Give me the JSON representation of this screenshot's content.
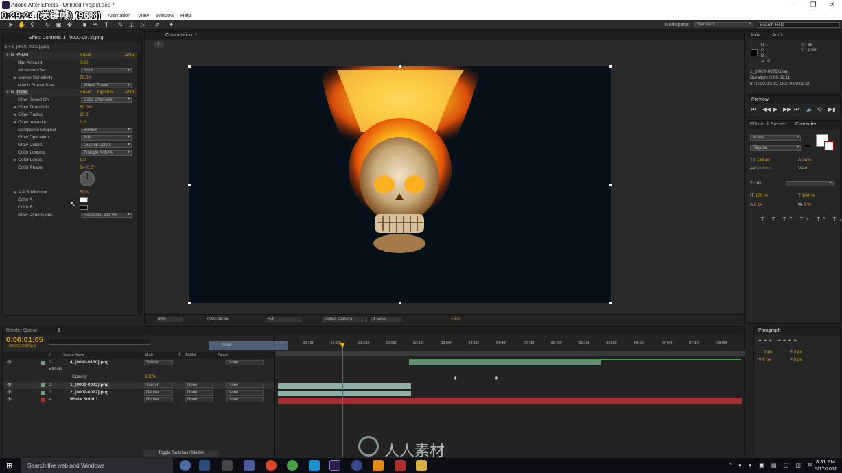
{
  "window": {
    "title": "Adobe After Effects - Untitled Project.aep *"
  },
  "overlay": {
    "timecode": "0:29:24 (关键帧) (96%)"
  },
  "menu": [
    "File",
    "Edit",
    "Composition",
    "Layer",
    "Effect",
    "Animation",
    "View",
    "Window",
    "Help"
  ],
  "toolbar": {
    "workspace_label": "Workspace:",
    "workspace_value": "Standard",
    "search_placeholder": "Search Help"
  },
  "effect_controls": {
    "tab": "Effect Controls: 1_[0000-0072].png",
    "breadcrumb": "1 • 1_[0000-0072].png",
    "rsmb": {
      "name": "RSMB",
      "reset": "Reset",
      "about": "Abou",
      "params": [
        {
          "label": "Blur Amount",
          "value": "0.80"
        },
        {
          "label": "Alt Motion Src",
          "value": "None"
        },
        {
          "label": "Motion Sensitivity",
          "value": "70.00"
        },
        {
          "label": "Match Frame Size",
          "value": "Whole Frame"
        }
      ]
    },
    "glow": {
      "name": "Glow",
      "reset": "Reset",
      "options": "Options...",
      "about": "Abou",
      "params": [
        {
          "label": "Glow Based On",
          "value": "Color Channels"
        },
        {
          "label": "Glow Threshold",
          "value": "60.0%"
        },
        {
          "label": "Glow Radius",
          "value": "10.0"
        },
        {
          "label": "Glow Intensity",
          "value": "1.0"
        },
        {
          "label": "Composite Original",
          "value": "Behind"
        },
        {
          "label": "Glow Operation",
          "value": "Add"
        },
        {
          "label": "Glow Colors",
          "value": "Original Colors"
        },
        {
          "label": "Color Looping",
          "value": "Triangle A>B>A"
        },
        {
          "label": "Color Loops",
          "value": "1.0"
        },
        {
          "label": "Color Phase",
          "value": "0x+0.0°"
        },
        {
          "label": "A & B Midpoint",
          "value": "50%"
        },
        {
          "label": "Color A",
          "value": ""
        },
        {
          "label": "Color B",
          "value": ""
        },
        {
          "label": "Glow Dimensions",
          "value": "Horizontal and Ver"
        }
      ]
    }
  },
  "composition": {
    "tab": "Composition: 1",
    "crumb": "1",
    "footer": {
      "zoom": "50%",
      "timecode": "0:00:01:05",
      "resolution": "Full",
      "camera": "Active Camera",
      "view": "1 View",
      "exposure": "+0.0"
    }
  },
  "info": {
    "tab": "Info",
    "audio_tab": "Audio",
    "r": "R :",
    "g": "G :",
    "b": "B :",
    "a": "A : 0",
    "x": "X : 66",
    "y": "Y : 1080",
    "file": "1_[0000-0072].png",
    "duration": "Duration: 0:00:02:11",
    "inout": "In: 0:00:00:00, Out: 0:00:02:10"
  },
  "preview": {
    "tab": "Preview"
  },
  "effects_presets": {
    "tab": "Effects & Presets"
  },
  "character": {
    "tab": "Character",
    "font": "Aceris",
    "style": "Regular",
    "size": "183 px",
    "leading": "Auto",
    "kerning": "Metrics",
    "tracking": "0",
    "stroke": "- px",
    "vscale": "100 %",
    "hscale": "100 %",
    "baseline": "0 px",
    "tsume": "0 %"
  },
  "paragraph": {
    "tab": "Paragraph",
    "v1": "0 px",
    "v2": "0 px",
    "v3": "0 px",
    "v4": "0 px",
    "v5": "0 px"
  },
  "timeline": {
    "render_queue": "Render Queue",
    "comp_tab": "1",
    "timecode": "0:00:01:05",
    "fps": "00035 (30.00 fps)",
    "headers": {
      "num": "#",
      "source": "Source Name",
      "mode": "Mode",
      "t": "T",
      "trkmat": "TrkMat",
      "parent": "Parent"
    },
    "ruler": [
      "0:00f",
      "00:15f",
      "01:00f",
      "01:15f",
      "02:00f",
      "02:15f",
      "03:00f",
      "03:15f",
      "04:00f",
      "04:15f",
      "05:00f",
      "05:15f",
      "06:00f",
      "06:15f",
      "07:00f",
      "07:15f",
      "08:00f"
    ],
    "layers": [
      {
        "num": "1",
        "name": "4_[0030-0170].png",
        "mode": "Screen",
        "trkmat": "",
        "parent": "None",
        "color": "#7a9a8a"
      },
      {
        "num": "2",
        "name": "1_[0000-0072].png",
        "mode": "Screen",
        "trkmat": "None",
        "parent": "None",
        "color": "#7a9a8a"
      },
      {
        "num": "3",
        "name": "2_[0000-0072].png",
        "mode": "Normal",
        "trkmat": "None",
        "parent": "None",
        "color": "#7a9a8a"
      },
      {
        "num": "4",
        "name": "White Solid 1",
        "mode": "Normal",
        "trkmat": "None",
        "parent": "None",
        "color": "#b03030"
      }
    ],
    "effects_label": "Effects",
    "opacity_label": "Opacity",
    "opacity_value": "100%",
    "glow_tooltip": "Glow",
    "toggle_label": "Toggle Switches / Modes"
  },
  "taskbar": {
    "search": "Search the web and Windows",
    "time": "8:31 PM",
    "date": "5/17/2016"
  },
  "watermark": {
    "text": "人人素材"
  }
}
